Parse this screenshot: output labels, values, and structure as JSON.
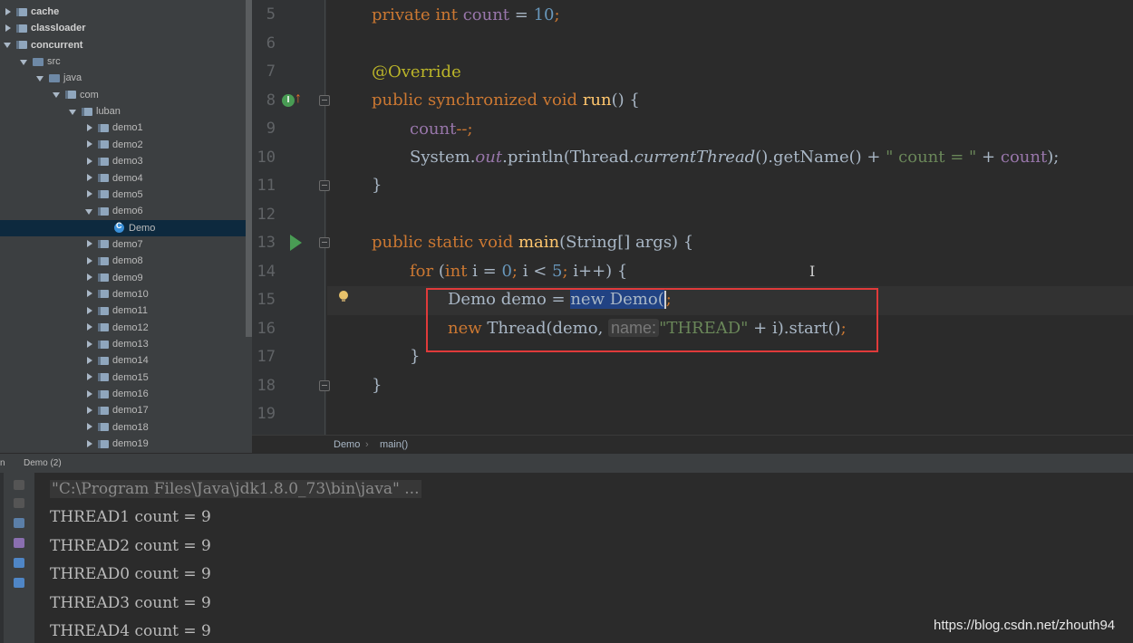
{
  "project_tree": {
    "items": [
      {
        "label": "cache",
        "depth": 0,
        "arrow": "right",
        "icon": "package-folder-icon",
        "bold": true
      },
      {
        "label": "classloader",
        "depth": 0,
        "arrow": "right",
        "icon": "package-folder-icon",
        "bold": true
      },
      {
        "label": "concurrent",
        "depth": 0,
        "arrow": "down",
        "icon": "module-folder-icon",
        "bold": true
      },
      {
        "label": "src",
        "depth": 1,
        "arrow": "down",
        "icon": "source-folder-icon",
        "bold": false
      },
      {
        "label": "java",
        "depth": 2,
        "arrow": "down",
        "icon": "source-folder-icon",
        "bold": false
      },
      {
        "label": "com",
        "depth": 3,
        "arrow": "down",
        "icon": "package-folder-icon",
        "bold": false
      },
      {
        "label": "luban",
        "depth": 4,
        "arrow": "down",
        "icon": "package-folder-icon",
        "bold": false
      },
      {
        "label": "demo1",
        "depth": 5,
        "arrow": "right",
        "icon": "package-folder-icon",
        "bold": false
      },
      {
        "label": "demo2",
        "depth": 5,
        "arrow": "right",
        "icon": "package-folder-icon",
        "bold": false
      },
      {
        "label": "demo3",
        "depth": 5,
        "arrow": "right",
        "icon": "package-folder-icon",
        "bold": false
      },
      {
        "label": "demo4",
        "depth": 5,
        "arrow": "right",
        "icon": "package-folder-icon",
        "bold": false
      },
      {
        "label": "demo5",
        "depth": 5,
        "arrow": "right",
        "icon": "package-folder-icon",
        "bold": false
      },
      {
        "label": "demo6",
        "depth": 5,
        "arrow": "down",
        "icon": "package-folder-icon",
        "bold": false
      },
      {
        "label": "Demo",
        "depth": 6,
        "arrow": "none",
        "icon": "java-class-icon",
        "bold": false,
        "selected": true
      },
      {
        "label": "demo7",
        "depth": 5,
        "arrow": "right",
        "icon": "package-folder-icon",
        "bold": false
      },
      {
        "label": "demo8",
        "depth": 5,
        "arrow": "right",
        "icon": "package-folder-icon",
        "bold": false
      },
      {
        "label": "demo9",
        "depth": 5,
        "arrow": "right",
        "icon": "package-folder-icon",
        "bold": false
      },
      {
        "label": "demo10",
        "depth": 5,
        "arrow": "right",
        "icon": "package-folder-icon",
        "bold": false
      },
      {
        "label": "demo11",
        "depth": 5,
        "arrow": "right",
        "icon": "package-folder-icon",
        "bold": false
      },
      {
        "label": "demo12",
        "depth": 5,
        "arrow": "right",
        "icon": "package-folder-icon",
        "bold": false
      },
      {
        "label": "demo13",
        "depth": 5,
        "arrow": "right",
        "icon": "package-folder-icon",
        "bold": false
      },
      {
        "label": "demo14",
        "depth": 5,
        "arrow": "right",
        "icon": "package-folder-icon",
        "bold": false
      },
      {
        "label": "demo15",
        "depth": 5,
        "arrow": "right",
        "icon": "package-folder-icon",
        "bold": false
      },
      {
        "label": "demo16",
        "depth": 5,
        "arrow": "right",
        "icon": "package-folder-icon",
        "bold": false
      },
      {
        "label": "demo17",
        "depth": 5,
        "arrow": "right",
        "icon": "package-folder-icon",
        "bold": false
      },
      {
        "label": "demo18",
        "depth": 5,
        "arrow": "right",
        "icon": "package-folder-icon",
        "bold": false
      },
      {
        "label": "demo19",
        "depth": 5,
        "arrow": "right",
        "icon": "package-folder-icon",
        "bold": false
      }
    ]
  },
  "editor": {
    "line_numbers": [
      "5",
      "6",
      "7",
      "8",
      "9",
      "10",
      "11",
      "12",
      "13",
      "14",
      "15",
      "16",
      "17",
      "18",
      "19"
    ],
    "lines": {
      "l5": {
        "kw": "private int ",
        "fld": "count",
        "op": " = ",
        "num": "10",
        "end": ";"
      },
      "l7": {
        "ann": "@Override"
      },
      "l8": {
        "kw": "public synchronized void ",
        "fn": "run",
        "rest": "() {"
      },
      "l9": {
        "fld": "count",
        "kw": "--;"
      },
      "l10": {
        "a": "System.",
        "out": "out",
        "b": ".println(Thread.",
        "ct": "currentThread",
        "c": "().getName() + ",
        "str": "\" count = \"",
        "d": " + ",
        "fld": "count",
        "e": ");"
      },
      "l11": {
        "text": "}"
      },
      "l13": {
        "kw": "public static void ",
        "fn": "main",
        "rest": "(String[] args) {"
      },
      "l14": {
        "kw": "for ",
        "a": "(",
        "kw2": "int ",
        "b": "i = ",
        "n0": "0",
        "kw3": "; ",
        "c": "i < ",
        "n5": "5",
        "kw4": "; ",
        "d": "i++) {"
      },
      "l15": {
        "a": "Demo demo = ",
        "sel": "new Demo",
        "b": "(",
        "kw": ";"
      },
      "l16": {
        "kw": "new ",
        "a": "Thread(demo, ",
        "hint": "name:",
        "str": "\"THREAD\"",
        "b": " + i).start()",
        "kw2": ";"
      },
      "l17": {
        "text": "}"
      },
      "l18": {
        "text": "}"
      }
    },
    "breadcrumb": [
      "Demo",
      "main()"
    ],
    "colors": {
      "keyword": "#cc7832",
      "field": "#9876aa",
      "number": "#6897bb",
      "annotation": "#bbb529",
      "method": "#ffc66d",
      "string": "#6a8759",
      "highlight_box": "#e03a3a"
    }
  },
  "run_panel": {
    "tab_title": "Demo (2)",
    "left_label": "n",
    "command": "\"C:\\Program Files\\Java\\jdk1.8.0_73\\bin\\java\" ...",
    "output": [
      "THREAD1 count = 9",
      "THREAD2 count = 9",
      "THREAD0 count = 9",
      "THREAD3 count = 9",
      "THREAD4 count = 9"
    ]
  },
  "watermark": "https://blog.csdn.net/zhouth94"
}
